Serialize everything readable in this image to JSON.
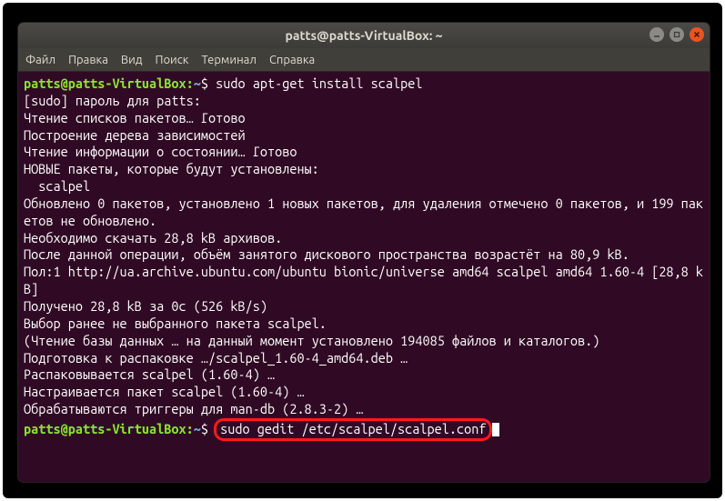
{
  "titlebar": {
    "title": "patts@patts-VirtualBox: ~"
  },
  "menu": {
    "file": "Файл",
    "edit": "Правка",
    "view": "Вид",
    "search": "Поиск",
    "terminal": "Терминал",
    "help": "Справка"
  },
  "prompt": {
    "userhost": "patts@patts-VirtualBox",
    "colon": ":",
    "path": "~",
    "sigil": "$"
  },
  "lines": {
    "cmd1": "sudo apt-get install scalpel",
    "l2": "[sudo] пароль для patts:",
    "l3": "Чтение списков пакетов… Готово",
    "l4": "Построение дерева зависимостей",
    "l5": "Чтение информации о состоянии… Готово",
    "l6": "НОВЫЕ пакеты, которые будут установлены:",
    "l7": "  scalpel",
    "l8": "Обновлено 0 пакетов, установлено 1 новых пакетов, для удаления отмечено 0 пакетов, и 199 пакетов не обновлено.",
    "l9": "Необходимо скачать 28,8 kB архивов.",
    "l10": "После данной операции, объём занятого дискового пространства возрастёт на 80,9 kB.",
    "l11": "Пол:1 http://ua.archive.ubuntu.com/ubuntu bionic/universe amd64 scalpel amd64 1.60-4 [28,8 kB]",
    "l12": "Получено 28,8 kB за 0с (526 kB/s)",
    "l13": "Выбор ранее не выбранного пакета scalpel.",
    "l14": "(Чтение базы данных … на данный момент установлено 194085 файлов и каталогов.)",
    "l15": "Подготовка к распаковке …/scalpel_1.60-4_amd64.deb …",
    "l16": "Распаковывается scalpel (1.60-4) …",
    "l17": "Настраивается пакет scalpel (1.60-4) …",
    "l18": "Обрабатываются триггеры для man-db (2.8.3-2) …",
    "cmd2": "sudo gedit /etc/scalpel/scalpel.conf"
  }
}
